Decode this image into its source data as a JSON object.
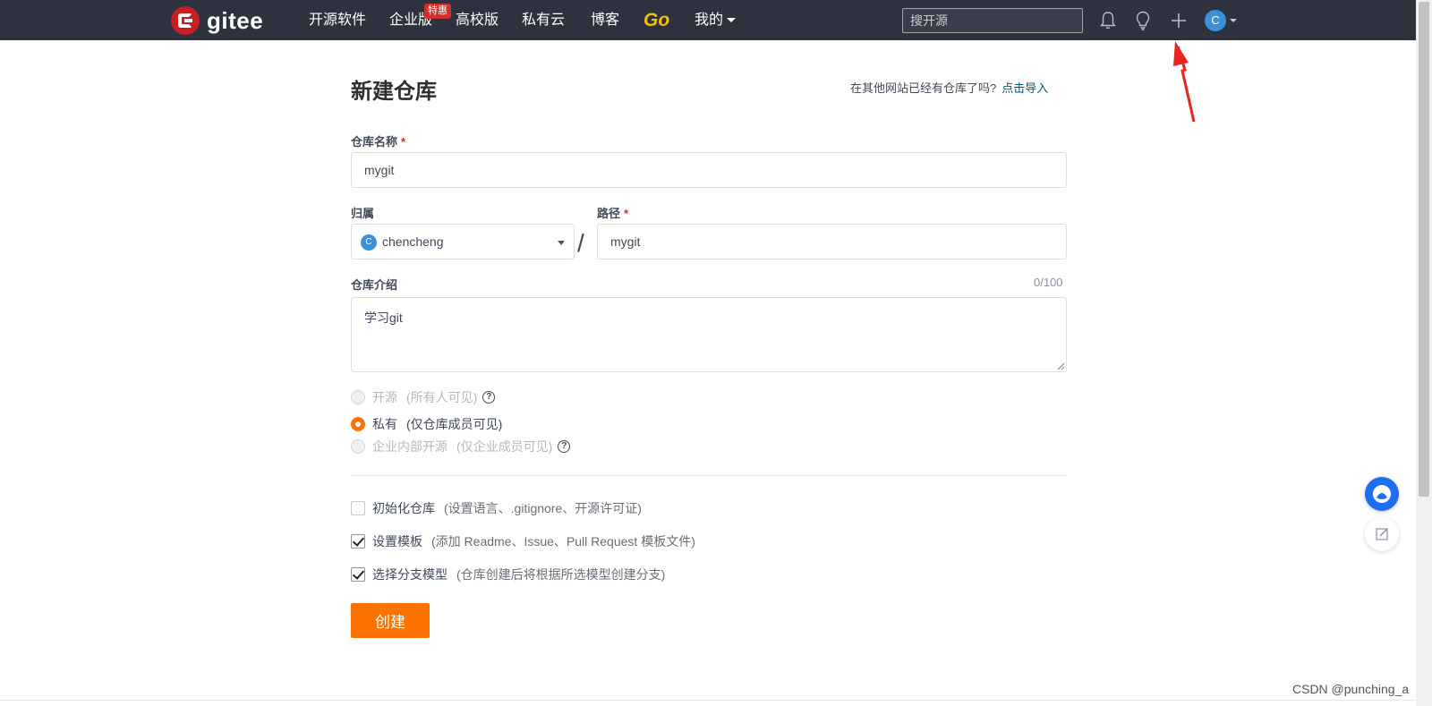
{
  "navbar": {
    "logo_text": "gitee",
    "items": [
      {
        "label": "开源软件"
      },
      {
        "label": "企业版"
      },
      {
        "label": "高校版"
      },
      {
        "label": "私有云"
      },
      {
        "label": "博客"
      }
    ],
    "enterprise_badge": "特惠",
    "go_label": "Go",
    "mine_label": "我的",
    "search_placeholder": "搜开源",
    "avatar_letter": "C"
  },
  "page": {
    "title": "新建仓库",
    "import_prompt": "在其他网站已经有仓库了吗?",
    "import_link": "点击导入"
  },
  "form": {
    "repo_name": {
      "label": "仓库名称",
      "required_mark": "*",
      "value": "mygit"
    },
    "owner": {
      "label": "归属",
      "value": "chencheng",
      "avatar_letter": "C"
    },
    "separator": "/",
    "path": {
      "label": "路径",
      "required_mark": "*",
      "value": "mygit"
    },
    "description": {
      "label": "仓库介绍",
      "counter": "0/100",
      "value": "学习git"
    },
    "visibility": [
      {
        "label": "开源",
        "hint": "(所有人可见)",
        "checked": false,
        "disabled": true,
        "help": "?"
      },
      {
        "label": "私有",
        "hint": "(仅仓库成员可见)",
        "checked": true,
        "disabled": false
      },
      {
        "label": "企业内部开源",
        "hint": "(仅企业成员可见)",
        "checked": false,
        "disabled": true,
        "help": "?"
      }
    ],
    "options": [
      {
        "label": "初始化仓库",
        "hint": "(设置语言、.gitignore、开源许可证)",
        "checked": false
      },
      {
        "label": "设置模板",
        "hint": "(添加 Readme、Issue、Pull Request 模板文件)",
        "checked": true
      },
      {
        "label": "选择分支模型",
        "hint": "(仓库创建后将根据所选模型创建分支)",
        "checked": true
      }
    ],
    "submit_label": "创建"
  },
  "watermark": "CSDN @punching_a",
  "colors": {
    "navbar_bg": "#2e323e",
    "accent_orange": "#fe7300",
    "link": "#005980",
    "required_red": "#db2828",
    "annotation_arrow": "#e8251f"
  }
}
